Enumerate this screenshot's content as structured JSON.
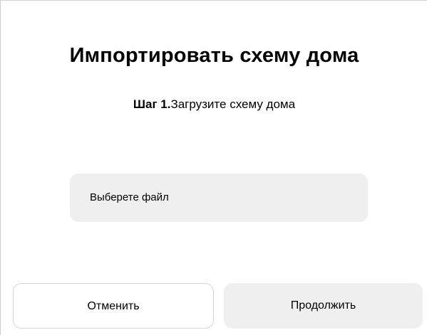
{
  "dialog": {
    "title": "Импортировать схему дома",
    "step": {
      "number": "Шаг 1.",
      "text": "Загрузите схему дома"
    },
    "file_picker": {
      "label": "Выберете файл"
    },
    "buttons": {
      "cancel_label": "Отменить",
      "continue_label": "Продолжить"
    }
  },
  "colors": {
    "background": "#ffffff",
    "field_background": "#efefef",
    "border": "#d6d6d6",
    "text": "#000000"
  }
}
